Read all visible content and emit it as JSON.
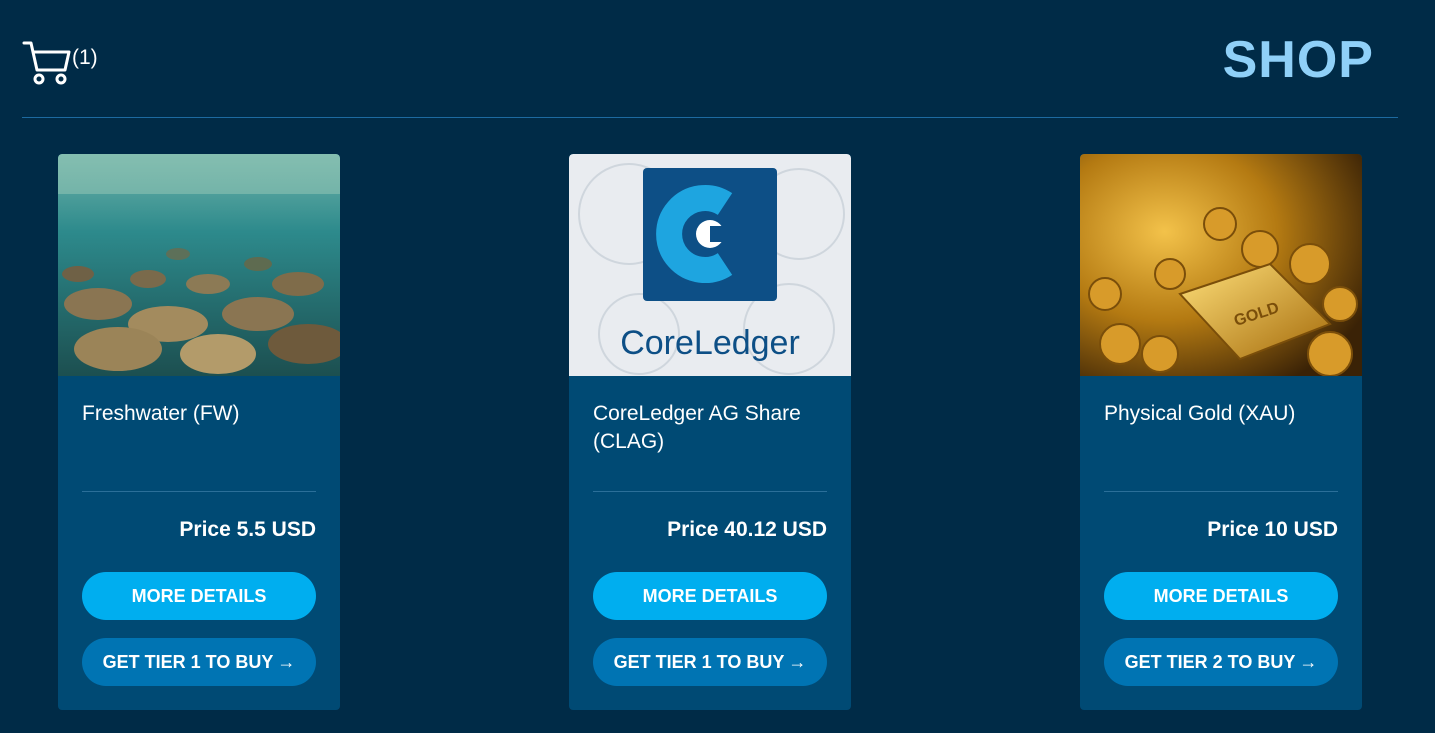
{
  "header": {
    "cart_count": "(1)",
    "title": "SHOP"
  },
  "products": [
    {
      "name": "Freshwater (FW)",
      "price": "Price 5.5 USD",
      "details_label": "MORE DETAILS",
      "buy_label": "GET TIER 1 TO BUY",
      "image": "underwater-stones"
    },
    {
      "name": "CoreLedger AG Share (CLAG)",
      "price": "Price 40.12 USD",
      "details_label": "MORE DETAILS",
      "buy_label": "GET TIER 1 TO BUY",
      "image": "coreledger-logo",
      "logo_text": "CoreLedger"
    },
    {
      "name": "Physical Gold (XAU)",
      "price": "Price 10 USD",
      "details_label": "MORE DETAILS",
      "buy_label": "GET TIER 2 TO BUY",
      "image": "gold-bars-coins",
      "bar_text": "GOLD"
    }
  ],
  "colors": {
    "background": "#002b47",
    "card": "#004a74",
    "title_accent": "#8fd0f8",
    "button_primary": "#00aeef",
    "button_secondary": "#0074b3"
  },
  "icons": {
    "cart": "cart-icon",
    "arrow": "arrow-right-icon"
  }
}
